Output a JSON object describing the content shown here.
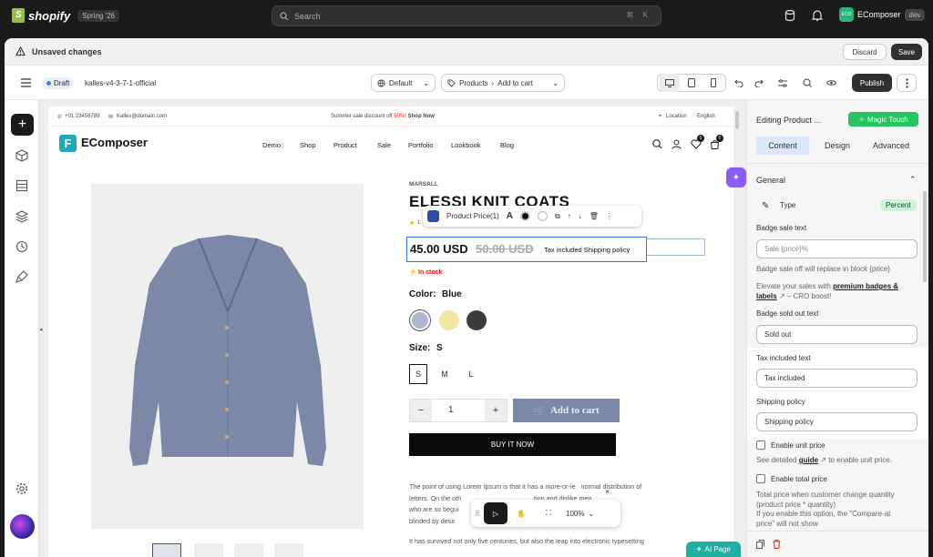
{
  "topbar": {
    "brand": "shopify",
    "edition": "Spring '26",
    "search_placeholder": "Search",
    "search_shortcut": "⌘ K",
    "store_initials": "ECO",
    "store_name": "EComposer",
    "store_badge": "dev"
  },
  "unsaved": {
    "title": "Unsaved changes",
    "discard": "Discard",
    "save": "Save"
  },
  "editor_bar": {
    "status": "Draft",
    "theme_name": "kalles-v4-3-7-1-official",
    "language": "Default",
    "breadcrumb_1": "Products",
    "breadcrumb_2": "Add to cart",
    "publish": "Publish"
  },
  "store_page": {
    "phone": "+01 23456789",
    "email": "Kalles@domain.com",
    "announce_pre": "Summer sale discount off",
    "announce_pct": "50%!",
    "announce_link": "Shop Now",
    "location": "Location",
    "locale": "English",
    "logo": "EComposer",
    "nav": [
      "Demo",
      "Shop",
      "Product",
      "Sale",
      "Portfolio",
      "Lookbook",
      "Blog"
    ],
    "wishlist_count": "0",
    "cart_count": "0",
    "vendor": "MARSALL",
    "product_title": "ELESSI KNIT COATS",
    "price": "45.00 USD",
    "compare_price": "50.00 USD",
    "tax_text": "Tax included Shipping policy",
    "stock": "In stock",
    "color_label": "Color:",
    "color_value": "Blue",
    "size_label": "Size:",
    "size_value": "S",
    "sizes": [
      "S",
      "M",
      "L"
    ],
    "qty": "1",
    "qty_minus": "−",
    "qty_plus": "+",
    "add_to_cart": "Add to cart",
    "buy_now": "BUY IT NOW",
    "desc_1": "The point of using Lorem Ipsum is that it has a more-or-le   normal distribution of",
    "desc_2": "letters. On the oth                                        tion and dislike men",
    "desc_3": "who are so begui                                           ure of the moment, so",
    "desc_4": "blinded by desir",
    "desc_5": "It has survived not only five centuries, but also the leap into electronic typesetting",
    "rating_count": "1"
  },
  "element_toolbar": {
    "label": "Product Price(1)"
  },
  "bottom_toolbar": {
    "zoom": "100%"
  },
  "ai_page": "AI Page",
  "right_panel": {
    "title": "Editing Product ...",
    "magic": "Magic Touch",
    "tabs": [
      "Content",
      "Design",
      "Advanced"
    ],
    "section": "General",
    "type_label": "Type",
    "type_value": "Percent",
    "badge_sale_label": "Badge sale text",
    "badge_sale_placeholder": "Sale {price}%",
    "badge_sale_help": "Badge sale off will replace in block {price}",
    "elevate_pre": "Elevate your sales with",
    "elevate_link": "premium badges & labels",
    "elevate_post": "– CRO boost!",
    "sold_out_label": "Badge sold out text",
    "sold_out_value": "Sold out",
    "tax_label": "Tax included text",
    "tax_value": "Tax included",
    "shipping_label": "Shipping policy",
    "shipping_value": "Shipping policy",
    "unit_price_label": "Enable unit price",
    "unit_help_pre": "See detailed",
    "unit_help_link": "guide",
    "unit_help_post": "to enable unit price.",
    "total_price_label": "Enable total price",
    "total_help_1": "Total price when customer change quantity",
    "total_help_2": "(product price * quantity)",
    "total_help_3": "If you enable this option, the \"Compare-at",
    "total_help_4": "price\" will not show"
  },
  "colors": {
    "accent_green": "#2db47a",
    "content_tab": "#dde8ff",
    "draft_dot": "#3b82f6",
    "product_gray": "#7b88a8"
  }
}
